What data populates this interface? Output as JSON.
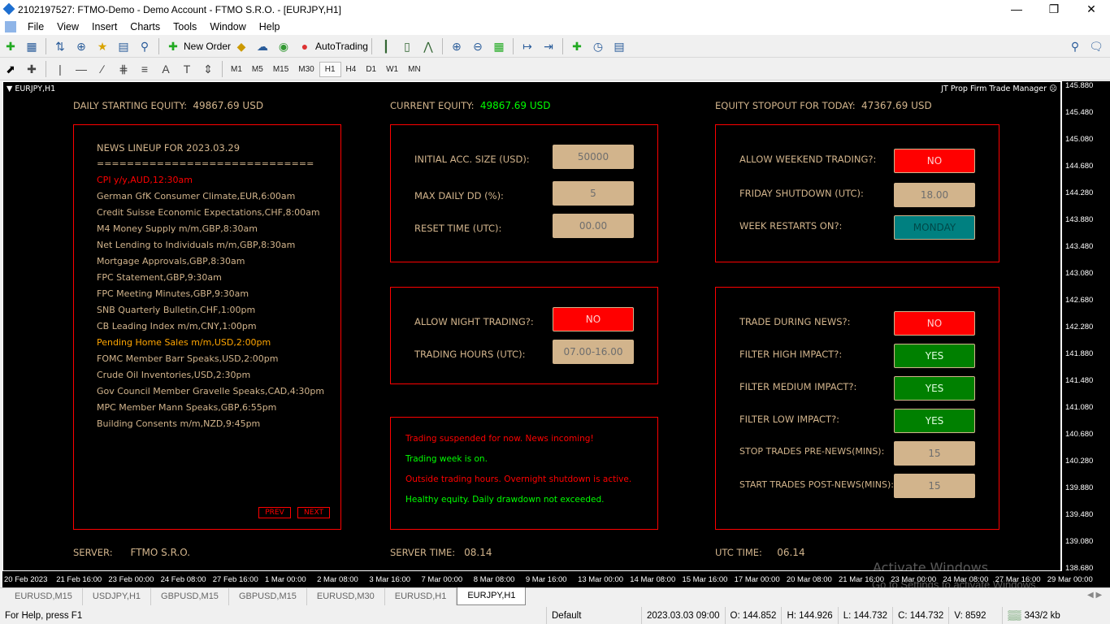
{
  "window": {
    "title": "2102197527: FTMO-Demo - Demo Account - FTMO S.R.O. - [EURJPY,H1]"
  },
  "menu": [
    "File",
    "View",
    "Insert",
    "Charts",
    "Tools",
    "Window",
    "Help"
  ],
  "toolbar": {
    "new_order": "New Order",
    "autotrading": "AutoTrading",
    "timeframes": [
      "M1",
      "M5",
      "M15",
      "M30",
      "H1",
      "H4",
      "D1",
      "W1",
      "MN"
    ],
    "selected_timeframe": "H1"
  },
  "chart": {
    "symbol": "EURJPY,H1",
    "ea_name": "JT Prop Firm Trade Manager",
    "prices": [
      "145.880",
      "145.480",
      "145.080",
      "144.680",
      "144.280",
      "143.880",
      "143.480",
      "143.080",
      "142.680",
      "142.280",
      "141.880",
      "141.480",
      "141.080",
      "140.680",
      "140.280",
      "139.880",
      "139.480",
      "139.080",
      "138.680"
    ],
    "times": [
      "20 Feb 2023",
      "21 Feb 16:00",
      "23 Feb 00:00",
      "24 Feb 08:00",
      "27 Feb 16:00",
      "1 Mar 00:00",
      "2 Mar 08:00",
      "3 Mar 16:00",
      "7 Mar 00:00",
      "8 Mar 08:00",
      "9 Mar 16:00",
      "13 Mar 00:00",
      "14 Mar 08:00",
      "15 Mar 16:00",
      "17 Mar 00:00",
      "20 Mar 08:00",
      "21 Mar 16:00",
      "23 Mar 00:00",
      "24 Mar 08:00",
      "27 Mar 16:00",
      "29 Mar 00:00"
    ]
  },
  "header": {
    "daily_label": "DAILY STARTING EQUITY:",
    "daily_value": "49867.69 USD",
    "current_label": "CURRENT EQUITY:",
    "current_value": "49867.69 USD",
    "stopout_label": "EQUITY STOPOUT FOR TODAY:",
    "stopout_value": "47367.69 USD"
  },
  "news": {
    "title": "NEWS LINEUP FOR 2023.03.29",
    "divider": "=============================",
    "items": [
      "CPI y/y,AUD,12:30am",
      "German GfK Consumer Climate,EUR,6:00am",
      "Credit Suisse Economic Expectations,CHF,8:00am",
      "M4 Money Supply m/m,GBP,8:30am",
      "Net Lending to Individuals m/m,GBP,8:30am",
      "Mortgage Approvals,GBP,8:30am",
      "FPC Statement,GBP,9:30am",
      "FPC Meeting Minutes,GBP,9:30am",
      "SNB Quarterly Bulletin,CHF,1:00pm",
      "CB Leading Index m/m,CNY,1:00pm",
      "Pending Home Sales m/m,USD,2:00pm",
      "FOMC Member Barr Speaks,USD,2:00pm",
      "Crude Oil Inventories,USD,2:30pm",
      "Gov Council Member Gravelle Speaks,CAD,4:30pm",
      "MPC Member Mann Speaks,GBP,6:55pm",
      "Building Consents m/m,NZD,9:45pm"
    ],
    "prev": "PREV",
    "next": "NEXT",
    "colors": {
      "high": "#ff0000",
      "medium": "#ffa500",
      "low": "#d2b48c"
    }
  },
  "account": {
    "size_label": "INITIAL ACC. SIZE (USD):",
    "size": "50000",
    "dd_label": "MAX DAILY DD (%):",
    "dd": "5",
    "reset_label": "RESET TIME (UTC):",
    "reset": "00.00"
  },
  "night": {
    "label": "ALLOW NIGHT TRADING?:",
    "value": "NO",
    "hours_label": "TRADING HOURS (UTC):",
    "hours": "07.00-16.00"
  },
  "messages": [
    "Trading suspended for now. News incoming!",
    "Trading week is on.",
    "Outside trading hours. Overnight shutdown is active.",
    "Healthy equity. Daily drawdown not exceeded."
  ],
  "weekend": {
    "label": "ALLOW WEEKEND TRADING?:",
    "value": "NO",
    "friday_label": "FRIDAY SHUTDOWN (UTC):",
    "friday": "18.00",
    "restart_label": "WEEK RESTARTS ON?:",
    "restart": "MONDAY"
  },
  "newsfilter": {
    "during_label": "TRADE DURING NEWS?:",
    "during": "NO",
    "high_label": "FILTER HIGH IMPACT?:",
    "high": "YES",
    "med_label": "FILTER MEDIUM IMPACT?:",
    "med": "YES",
    "low_label": "FILTER LOW IMPACT?:",
    "low": "YES",
    "pre_label": "STOP TRADES PRE-NEWS(MINS):",
    "pre": "15",
    "post_label": "START TRADES POST-NEWS(MINS):",
    "post": "15"
  },
  "footer": {
    "server_label": "SERVER:",
    "server": "FTMO S.R.O.",
    "time_label": "SERVER TIME:",
    "time": "08.14",
    "utc_label": "UTC TIME:",
    "utc": "06.14"
  },
  "watermark": {
    "line1": "Activate Windows",
    "line2": "Go to Settings to activate Windows."
  },
  "tabs": [
    "EURUSD,M15",
    "USDJPY,H1",
    "GBPUSD,M15",
    "GBPUSD,M15",
    "EURUSD,M30",
    "EURUSD,H1",
    "EURJPY,H1"
  ],
  "status": {
    "help": "For Help, press F1",
    "profile": "Default",
    "datetime": "2023.03.03 09:00",
    "open": "O: 144.852",
    "high": "H: 144.926",
    "low": "L: 144.732",
    "close": "C: 144.732",
    "volume": "V: 8592",
    "traffic": "343/2 kb"
  }
}
